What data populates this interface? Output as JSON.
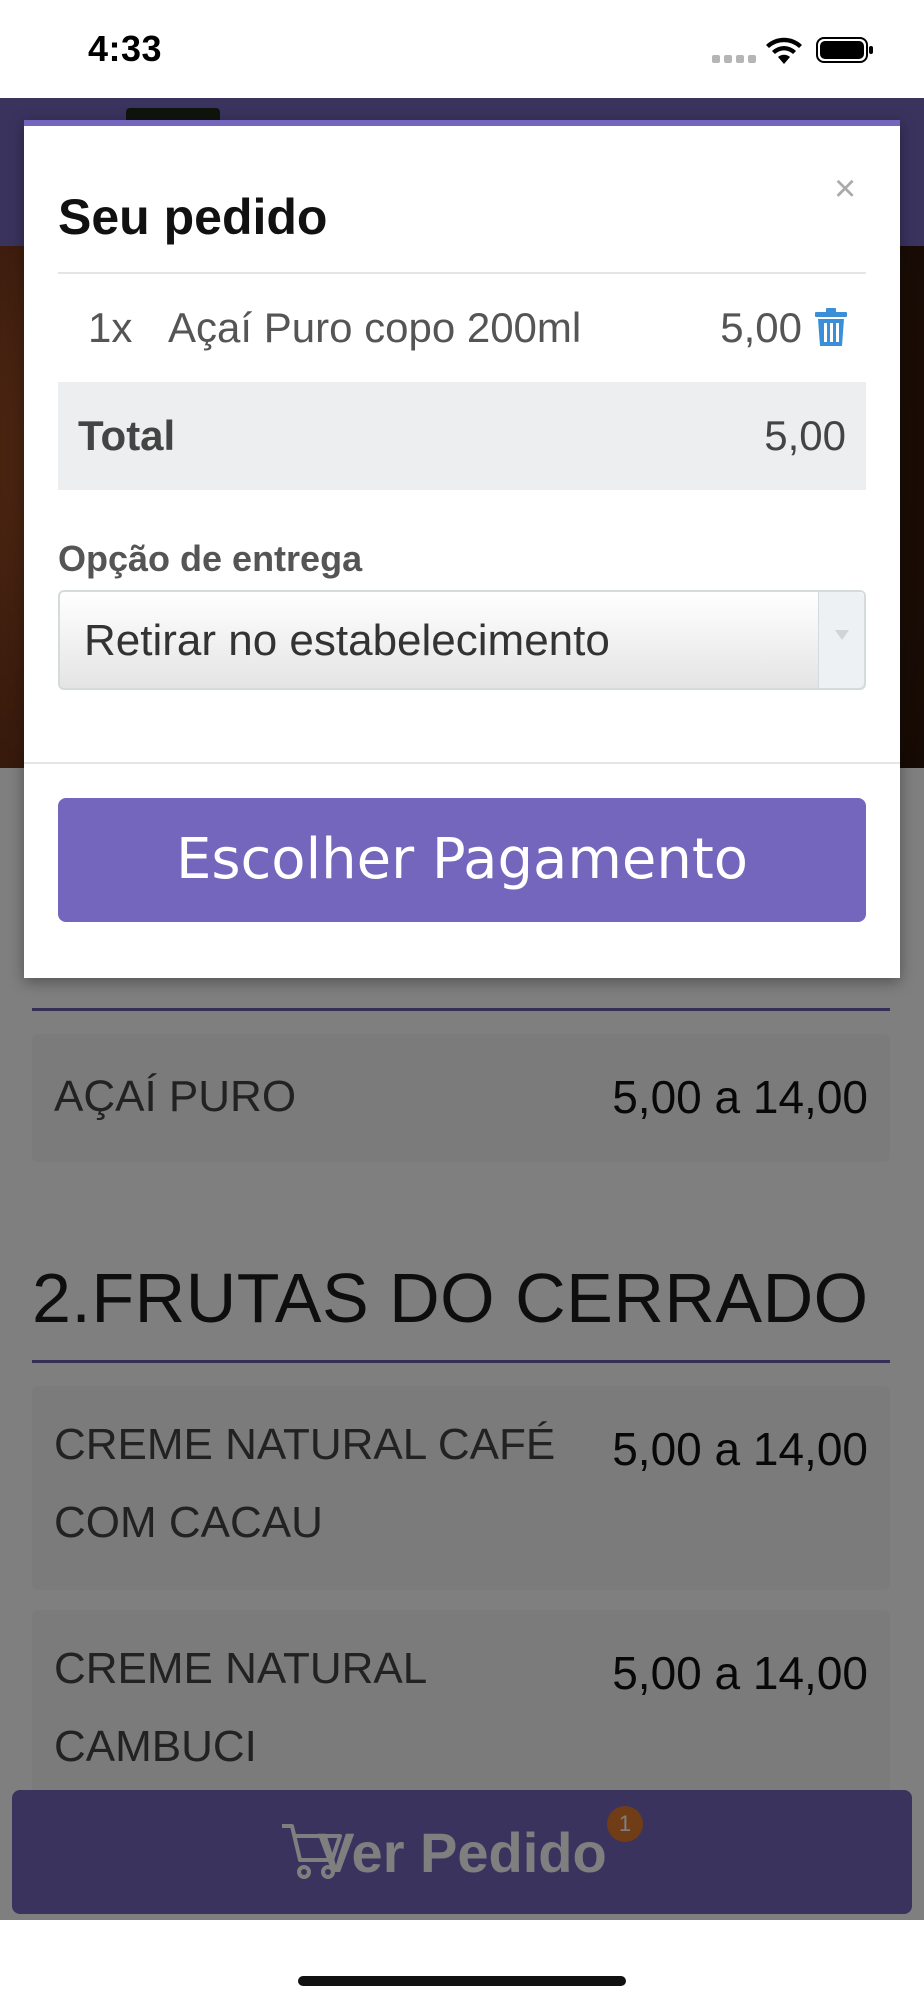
{
  "status_bar": {
    "time": "4:33"
  },
  "menu": {
    "sections": [
      {
        "title_partial": "",
        "items": [
          {
            "name": "AÇAÍ PURO",
            "price": "5,00 a 14,00"
          }
        ]
      },
      {
        "title": "2.FRUTAS DO CERRADO",
        "items": [
          {
            "name": "CREME NATURAL CAFÉ COM CACAU",
            "price": "5,00 a 14,00"
          },
          {
            "name": "CREME NATURAL CAMBUCI",
            "price": "5,00 a 14,00"
          }
        ]
      }
    ]
  },
  "cart_bar": {
    "label": "Ver Pedido",
    "badge_count": "1"
  },
  "modal": {
    "title": "Seu pedido",
    "close_symbol": "×",
    "order_items": [
      {
        "qty": "1x",
        "name": "Açaí Puro copo 200ml",
        "price": "5,00"
      }
    ],
    "total_label": "Total",
    "total_value": "5,00",
    "delivery_label": "Opção de entrega",
    "delivery_selected": "Retirar no estabelecimento",
    "pay_button": "Escolher Pagamento"
  },
  "colors": {
    "accent": "#7466bc",
    "badge": "#e07a2e",
    "trash": "#3b8fd9"
  },
  "icons": [
    "wifi-icon",
    "battery-icon",
    "trash-icon",
    "cart-icon",
    "close-icon",
    "chevron-down-icon"
  ]
}
